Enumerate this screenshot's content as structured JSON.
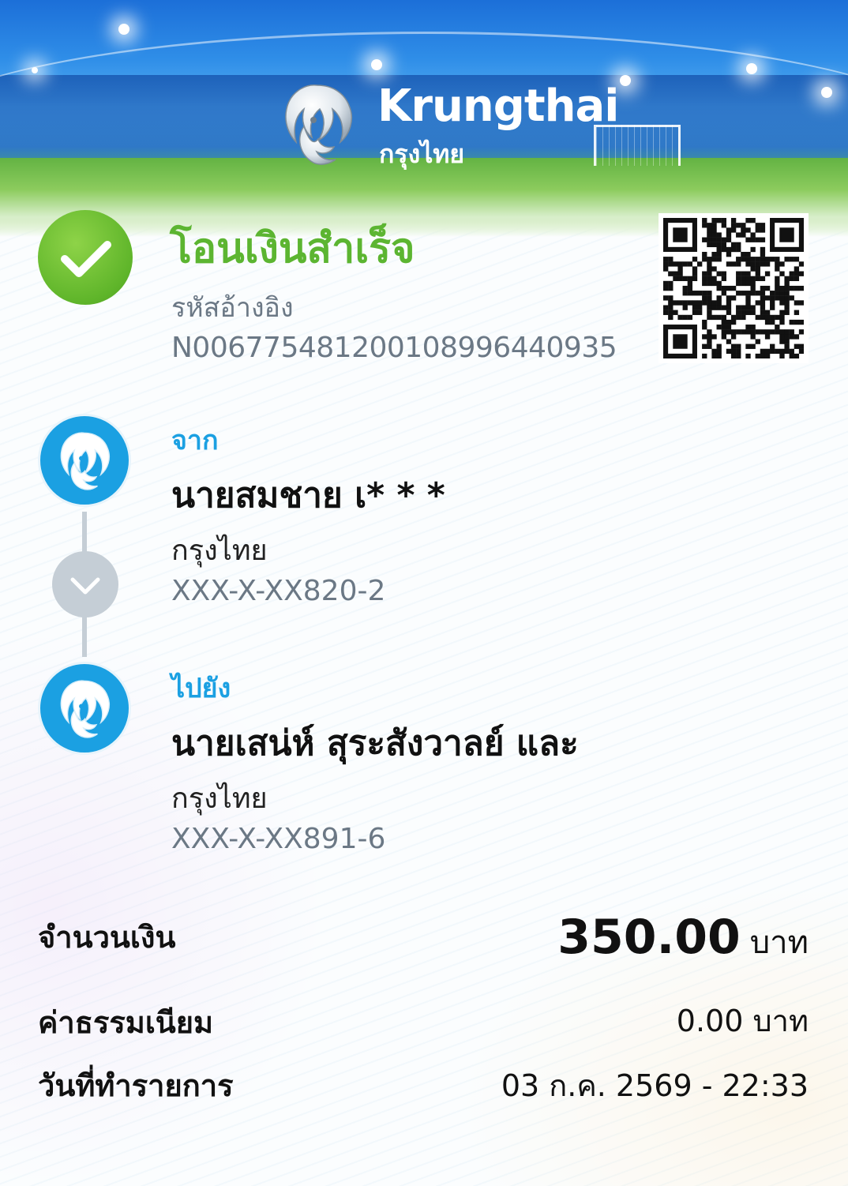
{
  "brand": {
    "name_en": "Krungthai",
    "name_th": "กรุงไทย"
  },
  "status": {
    "title": "โอนเงินสำเร็จ",
    "ref_label": "รหัสอ้างอิง",
    "ref_value": "N006775481200108996440935",
    "icon": "check-icon"
  },
  "from": {
    "label": "จาก",
    "name": "นายสมชาย เ* * *",
    "bank": "กรุงไทย",
    "account": "XXX-X-XX820-2"
  },
  "to": {
    "label": "ไปยัง",
    "name": "นายเสน่ห์ สุระสังวาลย์ และ",
    "bank": "กรุงไทย",
    "account": "XXX-X-XX891-6"
  },
  "summary": {
    "amount_label": "จำนวนเงิน",
    "amount_value": "350.00",
    "amount_unit": "บาท",
    "fee_label": "ค่าธรรมเนียม",
    "fee_value": "0.00 บาท",
    "date_label": "วันที่ทำรายการ",
    "date_value": "03 ก.ค. 2569 - 22:33"
  },
  "colors": {
    "success": "#5cb531",
    "accent": "#1ba0e2",
    "muted": "#6b7885",
    "connector": "#c5ced6"
  }
}
